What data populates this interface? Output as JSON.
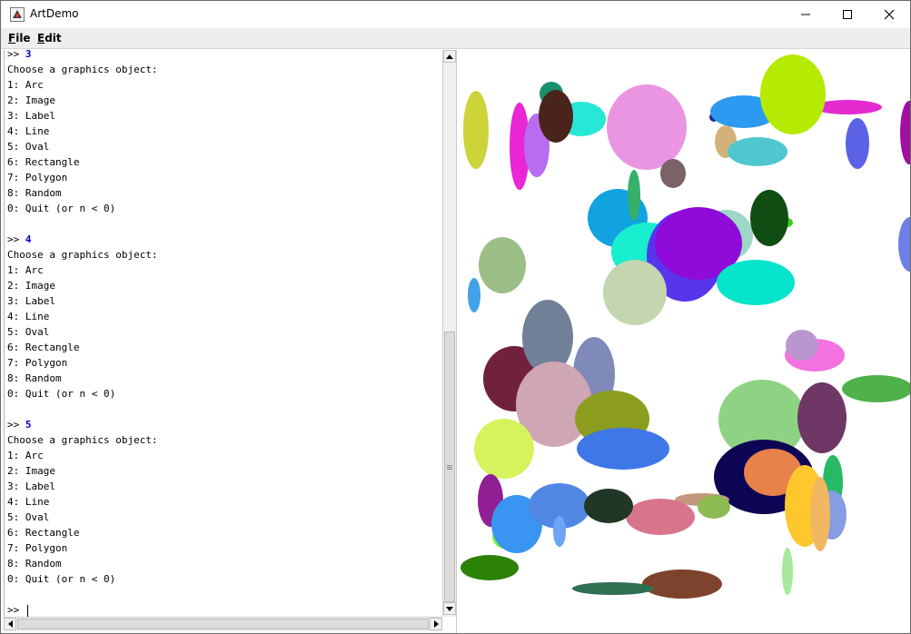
{
  "window": {
    "title": "ArtDemo",
    "app_icon": "java-duke-icon"
  },
  "menu": [
    {
      "label": "File",
      "mnemonic": "F"
    },
    {
      "label": "Edit",
      "mnemonic": "E"
    }
  ],
  "console": {
    "blocks": [
      {
        "input": "3",
        "header": "Choose a graphics object:",
        "options": [
          "1: Arc",
          "2: Image",
          "3: Label",
          "4: Line",
          "5: Oval",
          "6: Rectangle",
          "7: Polygon",
          "8: Random",
          "0: Quit (or n < 0)"
        ]
      },
      {
        "input": "4",
        "header": "Choose a graphics object:",
        "options": [
          "1: Arc",
          "2: Image",
          "3: Label",
          "4: Line",
          "5: Oval",
          "6: Rectangle",
          "7: Polygon",
          "8: Random",
          "0: Quit (or n < 0)"
        ]
      },
      {
        "input": "5",
        "header": "Choose a graphics object:",
        "options": [
          "1: Arc",
          "2: Image",
          "3: Label",
          "4: Line",
          "5: Oval",
          "6: Rectangle",
          "7: Polygon",
          "8: Random",
          "0: Quit (or n < 0)"
        ]
      }
    ],
    "prompt": ">>",
    "current_input": ""
  },
  "canvas": {
    "ovals": [
      {
        "color": "#cdd43a"
      },
      {
        "color": "#1a8f6e"
      },
      {
        "color": "#27e8d6"
      },
      {
        "color": "#ea26d5"
      },
      {
        "color": "#b96cf0"
      },
      {
        "color": "#4a241b"
      },
      {
        "color": "#ea95e1"
      },
      {
        "color": "#7a6266"
      },
      {
        "color": "#1a2a8f"
      },
      {
        "color": "#2c9af0"
      },
      {
        "color": "#e42bd0"
      },
      {
        "color": "#b5ea03"
      },
      {
        "color": "#d2b27a"
      },
      {
        "color": "#4fc7cf"
      },
      {
        "color": "#5b62e6"
      },
      {
        "color": "#a30fa1"
      },
      {
        "color": "#11a3e0"
      },
      {
        "color": "#36b06a"
      },
      {
        "color": "#9cd8c5"
      },
      {
        "color": "#18efce"
      },
      {
        "color": "#5835ed"
      },
      {
        "color": "#8f0bd9"
      },
      {
        "color": "#37cc22"
      },
      {
        "color": "#0f4d13"
      },
      {
        "color": "#c3d6b0"
      },
      {
        "color": "#06e4cb"
      },
      {
        "color": "#9cbf88"
      },
      {
        "color": "#42a2e7"
      },
      {
        "color": "#6b7fe6"
      },
      {
        "color": "#71213d"
      },
      {
        "color": "#7f8ab9"
      },
      {
        "color": "#708096"
      },
      {
        "color": "#cfa7b4"
      },
      {
        "color": "#8c9c1f"
      },
      {
        "color": "#3f76e8"
      },
      {
        "color": "#d6f35e"
      },
      {
        "color": "#f471e0"
      },
      {
        "color": "#ba96ce"
      },
      {
        "color": "#4fb14a"
      },
      {
        "color": "#8ed283"
      },
      {
        "color": "#6e3766"
      },
      {
        "color": "#8f1f92"
      },
      {
        "color": "#7cf23a"
      },
      {
        "color": "#3a94f1"
      },
      {
        "color": "#5088e4"
      },
      {
        "color": "#6da4f6"
      },
      {
        "color": "#0d0655"
      },
      {
        "color": "#e8814a"
      },
      {
        "color": "#ffc72e"
      },
      {
        "color": "#27b966"
      },
      {
        "color": "#869ce3"
      },
      {
        "color": "#f0b760"
      },
      {
        "color": "#c4977c"
      },
      {
        "color": "#d8748b"
      },
      {
        "color": "#213725"
      },
      {
        "color": "#8cbb52"
      },
      {
        "color": "#2b8207"
      },
      {
        "color": "#7e432d"
      },
      {
        "color": "#2f6f52"
      },
      {
        "color": "#a7e99b"
      }
    ]
  }
}
